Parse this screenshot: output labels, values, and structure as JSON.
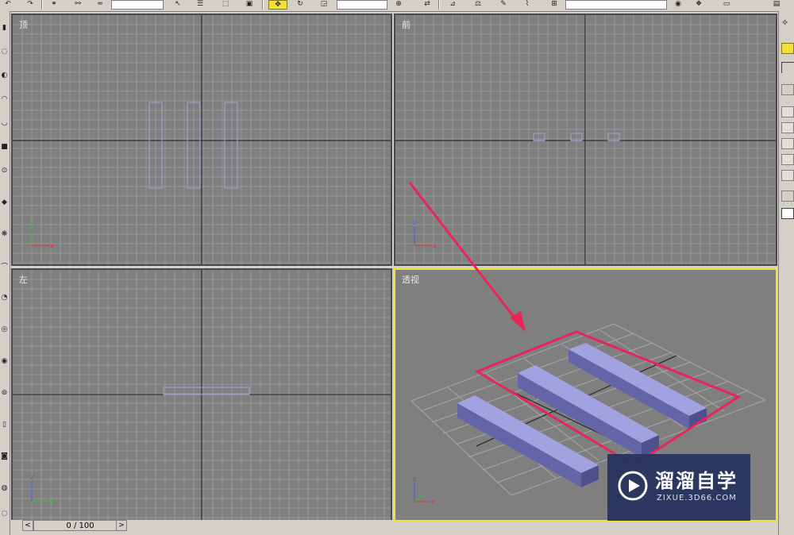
{
  "viewports": {
    "top": {
      "label": "顶"
    },
    "front": {
      "label": "前"
    },
    "left": {
      "label": "左"
    },
    "perspective": {
      "label": "透视"
    }
  },
  "timeline": {
    "frame_counter": "0 / 100",
    "prev_symbol": "<",
    "next_symbol": ">"
  },
  "toolbar": {
    "icons": [
      "undo-icon",
      "redo-icon",
      "link-icon",
      "unlink-icon",
      "bind-icon",
      "select-filter-dropdown",
      "select-icon",
      "select-by-name-icon",
      "rect-region-icon",
      "window-crossing-icon",
      "select-move-icon",
      "select-rotate-icon",
      "select-scale-icon",
      "reference-coord-dropdown",
      "pivot-icon",
      "mirror-icon",
      "align-icon",
      "spacing-icon",
      "named-selection-icon",
      "material-editor-icon",
      "render-icon"
    ],
    "active_tool": "select-move-icon"
  },
  "watermark": {
    "title": "溜溜自学",
    "subtitle": "ZIXUE.3D66.COM",
    "bg_color": "#2a3560"
  },
  "colors": {
    "viewport_bg": "#7f7f7f",
    "grid_line": "#9a9a9a",
    "axis_line": "#1a1a1a",
    "active_border": "#f0e040",
    "object_fill": "#7b7bbf",
    "annotation": "#e8245a"
  }
}
